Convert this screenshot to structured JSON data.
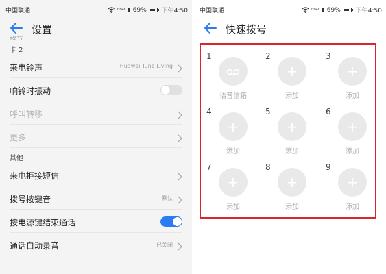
{
  "accent": "#2b7cf2",
  "highlight": "#d9262c",
  "status": {
    "carrier": "中国联通",
    "signal": "ᴴᴰ⁴⁶",
    "battery": "69%",
    "time": "下午4:50"
  },
  "left": {
    "title": "设置",
    "cut_text": "拨号",
    "sections": [
      {
        "header": "卡 2",
        "rows": [
          {
            "label": "来电铃声",
            "value": "Huawei Tune Living",
            "control": "chevron",
            "disabled": false
          },
          {
            "label": "响铃时振动",
            "value": "",
            "control": "toggle-off",
            "disabled": false
          },
          {
            "label": "呼叫转移",
            "value": "",
            "control": "chevron",
            "disabled": true
          },
          {
            "label": "更多",
            "value": "",
            "control": "chevron",
            "disabled": true
          }
        ]
      },
      {
        "header": "其他",
        "rows": [
          {
            "label": "来电拒接短信",
            "value": "",
            "control": "chevron",
            "disabled": false
          },
          {
            "label": "拨号按键音",
            "value": "默认",
            "control": "chevron",
            "disabled": false
          },
          {
            "label": "按电源键结束通话",
            "value": "",
            "control": "toggle-on",
            "disabled": false
          },
          {
            "label": "通话自动录音",
            "value": "已关闭",
            "control": "chevron",
            "disabled": false
          }
        ]
      }
    ]
  },
  "right": {
    "title": "快速拨号",
    "slots": [
      {
        "number": "1",
        "caption": "语音信箱",
        "icon": "voicemail-icon"
      },
      {
        "number": "2",
        "caption": "添加",
        "icon": "plus-icon"
      },
      {
        "number": "3",
        "caption": "添加",
        "icon": "plus-icon"
      },
      {
        "number": "4",
        "caption": "添加",
        "icon": "plus-icon"
      },
      {
        "number": "5",
        "caption": "添加",
        "icon": "plus-icon"
      },
      {
        "number": "6",
        "caption": "添加",
        "icon": "plus-icon"
      },
      {
        "number": "7",
        "caption": "添加",
        "icon": "plus-icon"
      },
      {
        "number": "8",
        "caption": "添加",
        "icon": "plus-icon"
      },
      {
        "number": "9",
        "caption": "添加",
        "icon": "plus-icon"
      }
    ]
  }
}
